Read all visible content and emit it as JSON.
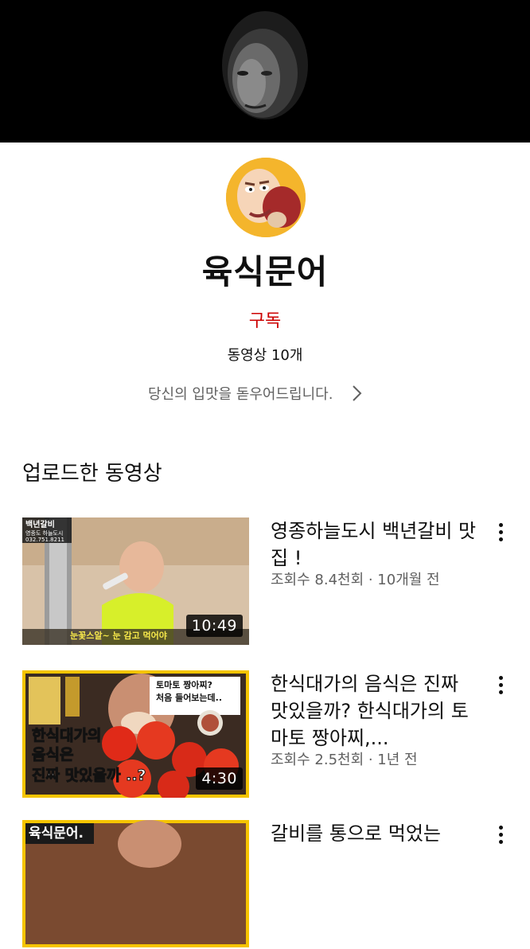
{
  "channel": {
    "name": "육식문어",
    "subscribe_label": "구독",
    "video_count": "동영상 10개",
    "description": "당신의 입맛을 돋우어드립니다."
  },
  "section": {
    "title": "업로드한 동영상"
  },
  "videos": [
    {
      "title": "영종하늘도시 백년갈비 맛집 !",
      "meta": "조회수 8.4천회 · 10개월 전",
      "duration": "10:49",
      "thumb_texts": [
        "백년갈비",
        "영종도 하늘도시",
        "032.751.8211",
        "눈꽃스알~ 눈 감고 먹어야"
      ]
    },
    {
      "title": "한식대가의 음식은 진짜 맛있을까? 한식대가의 토마토 짱아찌,...",
      "meta": "조회수 2.5천회 · 1년 전",
      "duration": "4:30",
      "thumb_texts": [
        "한식대가의",
        "음식은",
        "진짜 맛있을까 ..?",
        "토마토 짱아찌?",
        "처음 들어보는데.."
      ]
    },
    {
      "title": "갈비를 통으로 먹었는",
      "thumb_texts": [
        "육식문어."
      ]
    }
  ],
  "colors": {
    "subscribe": "#cc0000",
    "meta": "#606060",
    "thumb_border": "#f5c400"
  }
}
